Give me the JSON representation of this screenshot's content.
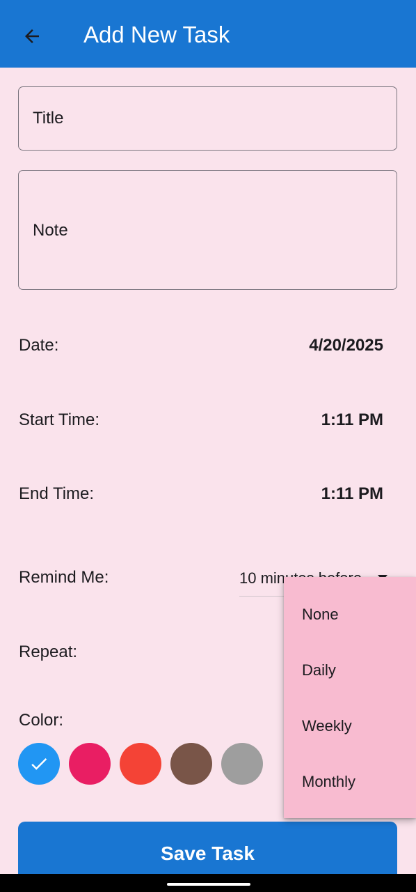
{
  "appbar": {
    "title": "Add New Task"
  },
  "form": {
    "title_placeholder": "Title",
    "note_placeholder": "Note",
    "date_label": "Date:",
    "date_value": "4/20/2025",
    "start_label": "Start Time:",
    "start_value": "1:11 PM",
    "end_label": "End Time:",
    "end_value": "1:11 PM",
    "remind_label": "Remind Me:",
    "remind_value": "10 minutes before",
    "repeat_label": "Repeat:",
    "color_label": "Color:"
  },
  "colors": {
    "selected_index": 0,
    "options": [
      "#2196f3",
      "#e91e63",
      "#f44336",
      "#795548",
      "#9e9e9e"
    ]
  },
  "repeat_menu": {
    "items": [
      "None",
      "Daily",
      "Weekly",
      "Monthly"
    ]
  },
  "save_button": {
    "label": "Save Task"
  },
  "theme": {
    "primary": "#1976d2",
    "background": "#fae3ec",
    "menu": "#f8bbd0"
  }
}
